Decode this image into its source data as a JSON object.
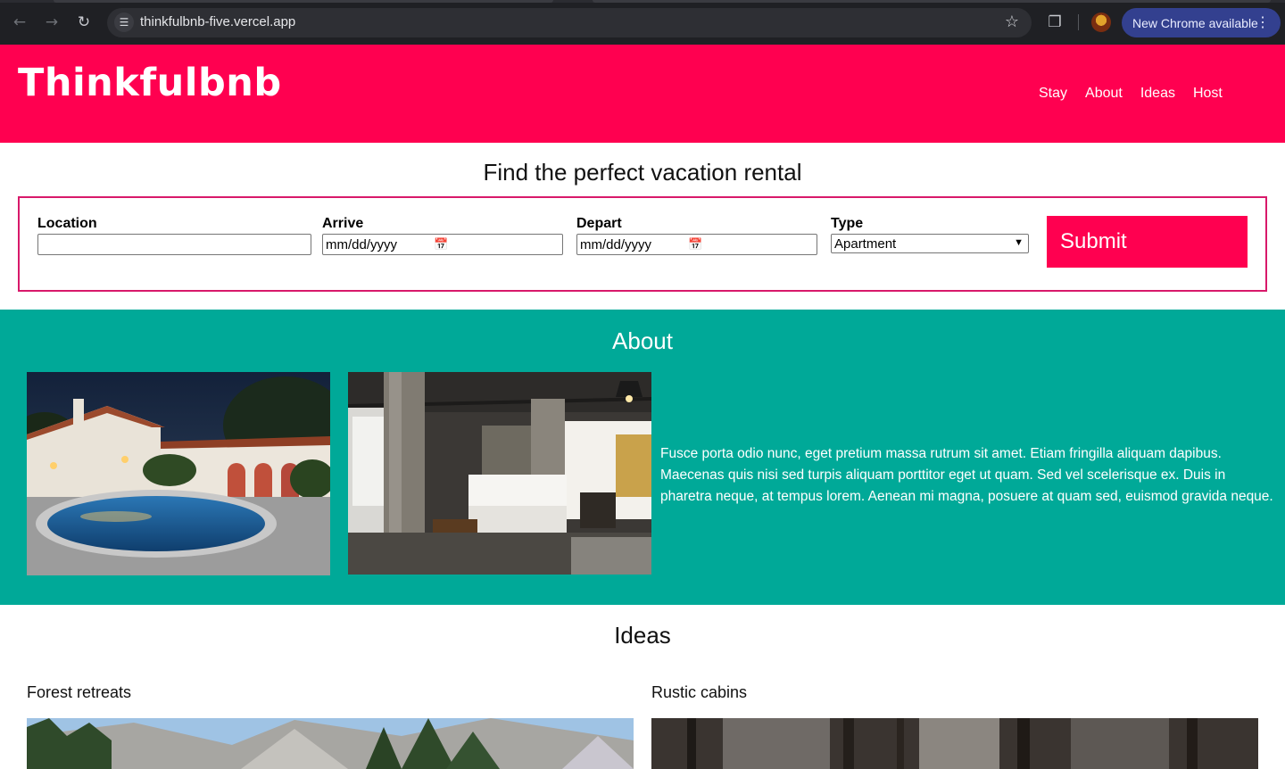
{
  "browser": {
    "url": "thinkfulbnb-five.vercel.app",
    "update_label": "New Chrome available",
    "icons": {
      "back": "arrow-left-icon",
      "forward": "arrow-right-icon",
      "reload": "reload-icon",
      "site_info": "tune-icon",
      "bookmark": "star-icon",
      "extensions": "puzzle-icon",
      "menu": "kebab-icon"
    }
  },
  "header": {
    "logo": "Thinkfulbnb",
    "nav": [
      "Stay",
      "About",
      "Ideas",
      "Host"
    ]
  },
  "search": {
    "title": "Find the perfect vacation rental",
    "location_label": "Location",
    "location_value": "",
    "arrive_label": "Arrive",
    "arrive_value": "mm/dd/yyyy",
    "depart_label": "Depart",
    "depart_value": "mm/dd/yyyy",
    "type_label": "Type",
    "type_value": "Apartment",
    "submit_label": "Submit"
  },
  "about": {
    "title": "About",
    "text": "Fusce porta odio nunc, eget pretium massa rutrum sit amet. Etiam fringilla aliquam dapibus. Maecenas quis nisi sed turpis aliquam porttitor eget ut quam. Sed vel scelerisque ex. Duis in pharetra neque, at tempus lorem. Aenean mi magna, posuere at quam sed, euismod gravida neque."
  },
  "ideas": {
    "title": "Ideas",
    "items": [
      {
        "label": "Forest retreats"
      },
      {
        "label": "Rustic cabins"
      }
    ]
  },
  "colors": {
    "brand_pink": "#ff0050",
    "about_teal": "#00a998",
    "form_border": "#d8196a"
  }
}
